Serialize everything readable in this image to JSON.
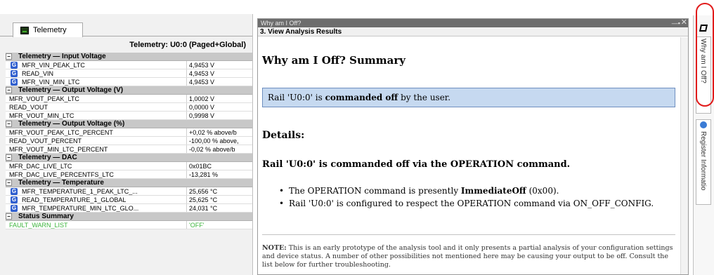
{
  "telemetry": {
    "tab_label": "Telemetry",
    "panel_title": "Telemetry: U0:0 (Paged+Global)",
    "rows": [
      {
        "kind": "section",
        "label": "Telemetry — Input Voltage"
      },
      {
        "kind": "g",
        "name": "MFR_VIN_PEAK_LTC",
        "value": "4,9453 V"
      },
      {
        "kind": "g",
        "name": "READ_VIN",
        "value": "4,9453 V"
      },
      {
        "kind": "g",
        "name": "MFR_VIN_MIN_LTC",
        "value": "4,9453 V"
      },
      {
        "kind": "section",
        "label": "Telemetry — Output Voltage (V)"
      },
      {
        "kind": "plain",
        "name": "MFR_VOUT_PEAK_LTC",
        "value": "1,0002 V"
      },
      {
        "kind": "plain",
        "name": "READ_VOUT",
        "value": "0,0000 V"
      },
      {
        "kind": "plain",
        "name": "MFR_VOUT_MIN_LTC",
        "value": "0,9998 V"
      },
      {
        "kind": "section",
        "label": "Telemetry — Output Voltage (%)"
      },
      {
        "kind": "plain",
        "name": "MFR_VOUT_PEAK_LTC_PERCENT",
        "value": "+0,02 % above/b"
      },
      {
        "kind": "plain",
        "name": "READ_VOUT_PERCENT",
        "value": "-100,00 % above,"
      },
      {
        "kind": "plain",
        "name": "MFR_VOUT_MIN_LTC_PERCENT",
        "value": "-0,02 % above/b"
      },
      {
        "kind": "section",
        "label": "Telemetry — DAC"
      },
      {
        "kind": "plain",
        "name": "MFR_DAC_LIVE_LTC",
        "value": "0x01BC"
      },
      {
        "kind": "plain",
        "name": "MFR_DAC_LIVE_PERCENTFS_LTC",
        "value": "-13,281 %"
      },
      {
        "kind": "section",
        "label": "Telemetry — Temperature"
      },
      {
        "kind": "g",
        "name": "MFR_TEMPERATURE_1_PEAK_LTC_...",
        "value": "25,656 °C"
      },
      {
        "kind": "g",
        "name": "READ_TEMPERATURE_1_GLOBAL",
        "value": "25,625 °C"
      },
      {
        "kind": "g",
        "name": "MFR_TEMPERATURE_MIN_LTC_GLO...",
        "value": "24,031 °C"
      },
      {
        "kind": "section",
        "label": "Status Summary"
      },
      {
        "kind": "green",
        "name": "FAULT_WARN_LIST",
        "value": "'OFF'"
      }
    ]
  },
  "analysis": {
    "window_title": "Why am I Off?",
    "step_label": "3. View Analysis Results",
    "summary_heading": "Why am I Off? Summary",
    "status_prefix": "Rail 'U0:0' is ",
    "status_bold": "commanded off",
    "status_suffix": " by the user.",
    "details_heading": "Details:",
    "reason_heading": "Rail 'U0:0' is commanded off via the OPERATION command.",
    "bullet1_prefix": "The OPERATION command is presently ",
    "bullet1_bold": "ImmediateOff",
    "bullet1_suffix": " (0x00).",
    "bullet2": "Rail 'U0:0' is configured to respect the OPERATION command via ON_OFF_CONFIG.",
    "note_label": "NOTE:",
    "note_text": " This is an early prototype of the analysis tool and it only presents a partial analysis of your configuration settings and device status. A number of other possibilities not mentioned here may be causing your output to be off. Consult the list below for further troubleshooting."
  },
  "side_tabs": {
    "why_tab": "Why am I Off?",
    "register_tab": "Register Informatio"
  },
  "colors": {
    "status_box_fill": "#c6d9f0",
    "highlight_ring": "#e11b1b",
    "g_icon": "#2f5fcf",
    "status_green": "#3cb43c"
  }
}
